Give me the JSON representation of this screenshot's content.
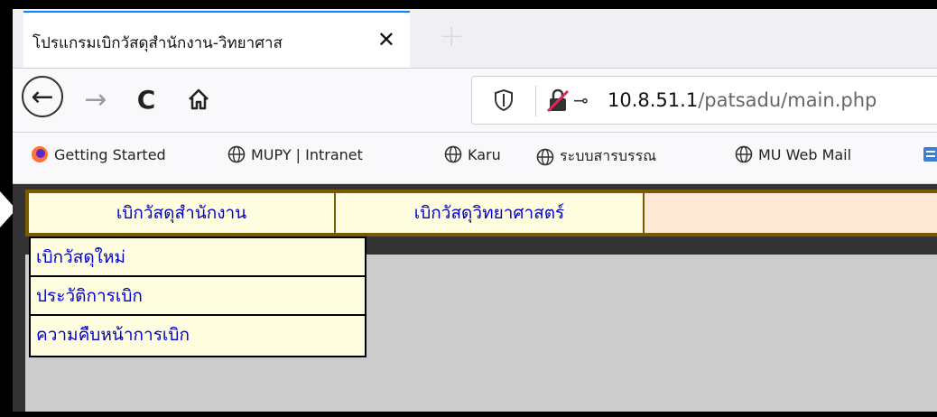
{
  "browser": {
    "tab": {
      "title": "โปรแกรมเบิกวัสดุสำนักงาน-วิทยาศาส",
      "close_glyph": "✕"
    },
    "new_tab_glyph": "+",
    "nav": {
      "back": "←",
      "forward": "→",
      "reload": "C",
      "home_icon": "home-icon"
    },
    "url": {
      "host": "10.8.51.1",
      "path": "/patsadu/main.php"
    },
    "bookmarks": [
      {
        "label": "Getting Started",
        "icon": "firefox-icon"
      },
      {
        "label": "MUPY | Intranet",
        "icon": "globe-icon"
      },
      {
        "label": "Karu",
        "icon": "globe-icon"
      },
      {
        "label": "ระบบสารบรรณ",
        "icon": "globe-icon"
      },
      {
        "label": "MU Web Mail",
        "icon": "globe-icon"
      }
    ]
  },
  "menu": {
    "items": [
      {
        "label": "เบิกวัสดุสำนักงาน"
      },
      {
        "label": "เบิกวัสดุวิทยาศาสตร์"
      }
    ],
    "dropdown": [
      {
        "label": "เบิกวัสดุใหม่"
      },
      {
        "label": "ประวัติการเบิก"
      },
      {
        "label": "ความคืบหน้าการเบิก"
      }
    ]
  },
  "colors": {
    "menu_text": "#0000cc",
    "menu_border": "#7a5a00",
    "menu_bg": "#fffde0",
    "menubar_bg": "#fde9d6",
    "content_bg": "#cccccc",
    "tab_accent": "#0a84ff"
  }
}
